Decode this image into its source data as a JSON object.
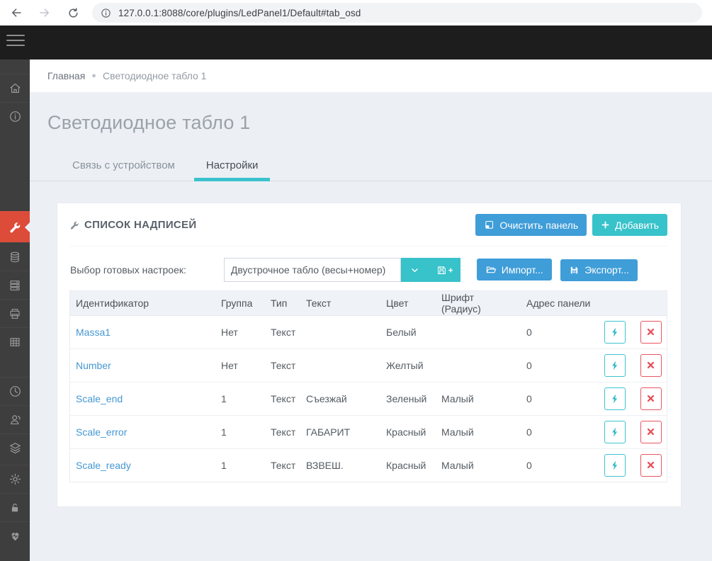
{
  "browser": {
    "url": "127.0.0.1:8088/core/plugins/LedPanel1/Default#tab_osd",
    "icons": [
      "back-arrow",
      "forward-arrow",
      "refresh",
      "page-info"
    ]
  },
  "topbar": {
    "icon": "hamburger-menu"
  },
  "sidebar": {
    "icons": [
      "home",
      "info",
      "wrench",
      "database",
      "server",
      "printer",
      "table-grid",
      "clock",
      "users",
      "layers",
      "gear",
      "lock",
      "heartbeat"
    ],
    "active_icon": "wrench",
    "active_color": "#dd4b39"
  },
  "breadcrumb": {
    "home": "Главная",
    "current": "Светодиодное табло 1"
  },
  "page": {
    "title": "Светодиодное табло 1"
  },
  "tabs": [
    {
      "label": "Связь с устройством",
      "active": false
    },
    {
      "label": "Настройки",
      "active": true
    }
  ],
  "panel": {
    "title": "СПИСОК НАДПИСЕЙ",
    "title_icon": "wrench-icon",
    "clear_button": "Очистить панель",
    "add_button": "Добавить",
    "presets": {
      "label": "Выбор готовых настроек:",
      "selected": "Двустрочное табло (весы+номер)",
      "dropdown_icon": "chevron-down",
      "save_icon": "floppy-plus",
      "import_button": "Импорт...",
      "export_button": "Экспорт..."
    },
    "table": {
      "headers": [
        "Идентификатор",
        "Группа",
        "Тип",
        "Текст",
        "Цвет",
        "Шрифт (Радиус)",
        "Адрес панели",
        ""
      ],
      "rows": [
        {
          "id": "Massa1",
          "group": "Нет",
          "type": "Текст",
          "text": "",
          "color": "Белый",
          "font": "",
          "address": "0"
        },
        {
          "id": "Number",
          "group": "Нет",
          "type": "Текст",
          "text": "",
          "color": "Желтый",
          "font": "",
          "address": "0"
        },
        {
          "id": "Scale_end",
          "group": "1",
          "type": "Текст",
          "text": "Съезжай",
          "color": "Зеленый",
          "font": "Малый",
          "address": "0"
        },
        {
          "id": "Scale_error",
          "group": "1",
          "type": "Текст",
          "text": "ГАБАРИТ",
          "color": "Красный",
          "font": "Малый",
          "address": "0"
        },
        {
          "id": "Scale_ready",
          "group": "1",
          "type": "Текст",
          "text": "ВЗВЕШ.",
          "color": "Красный",
          "font": "Малый",
          "address": "0"
        }
      ],
      "row_action_icons": [
        "bolt-icon",
        "delete-x-icon"
      ]
    }
  },
  "colors": {
    "accent_blue": "#3f9dd8",
    "accent_teal": "#38c2ca",
    "active_red": "#dd4b39",
    "link_blue": "#4697d3",
    "delete_red": "#e84f5b"
  }
}
